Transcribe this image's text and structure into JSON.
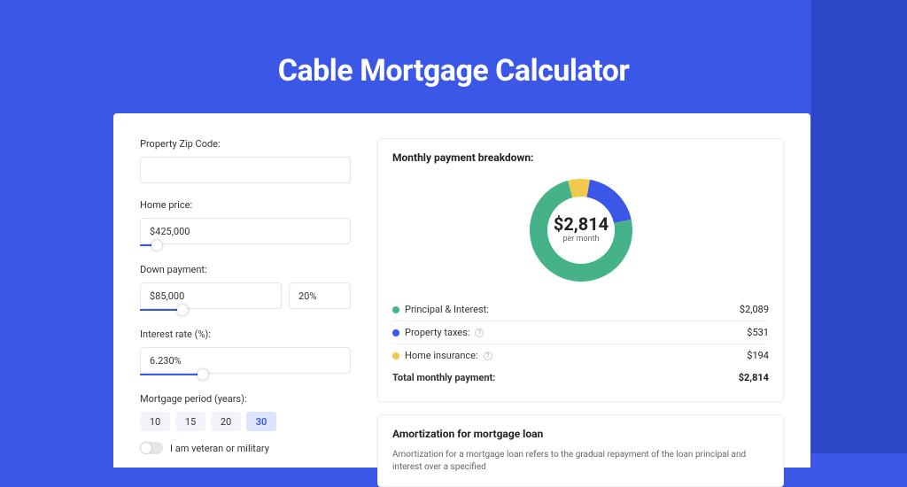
{
  "title": "Cable Mortgage Calculator",
  "form": {
    "zip_label": "Property Zip Code:",
    "zip_value": "",
    "home_price_label": "Home price:",
    "home_price_value": "$425,000",
    "home_price_slider_pct": 8,
    "down_payment_label": "Down payment:",
    "down_payment_value": "$85,000",
    "down_payment_pct_value": "20%",
    "down_payment_slider_pct": 20,
    "interest_label": "Interest rate (%):",
    "interest_value": "6.230%",
    "interest_slider_pct": 30,
    "period_label": "Mortgage period (years):",
    "periods": [
      "10",
      "15",
      "20",
      "30"
    ],
    "period_selected": "30",
    "veteran_label": "I am veteran or military"
  },
  "breakdown": {
    "title": "Monthly payment breakdown:",
    "center_value": "$2,814",
    "center_sub": "per month",
    "items": [
      {
        "label": "Principal & Interest:",
        "value": "$2,089",
        "color": "#46b289",
        "info": false
      },
      {
        "label": "Property taxes:",
        "value": "$531",
        "color": "#3a57e8",
        "info": true
      },
      {
        "label": "Home insurance:",
        "value": "$194",
        "color": "#f3c94b",
        "info": true
      }
    ],
    "total_label": "Total monthly payment:",
    "total_value": "$2,814"
  },
  "amortization": {
    "title": "Amortization for mortgage loan",
    "text": "Amortization for a mortgage loan refers to the gradual repayment of the loan principal and interest over a specified"
  },
  "chart_data": {
    "type": "pie",
    "title": "Monthly payment breakdown",
    "series": [
      {
        "name": "Principal & Interest",
        "value": 2089,
        "color": "#46b289"
      },
      {
        "name": "Property taxes",
        "value": 531,
        "color": "#3a57e8"
      },
      {
        "name": "Home insurance",
        "value": 194,
        "color": "#f3c94b"
      }
    ],
    "total": 2814,
    "center_label": "$2,814 per month",
    "donut": true
  }
}
